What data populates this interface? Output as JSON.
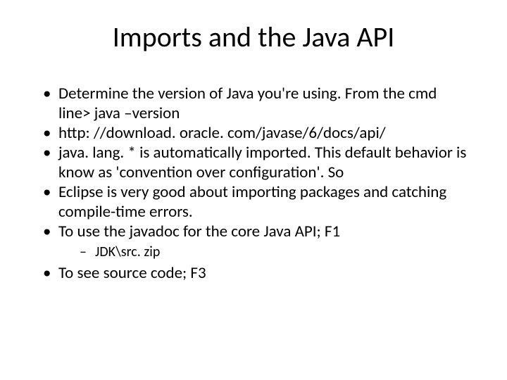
{
  "title": "Imports and the Java API",
  "bullets": {
    "b1": "Determine the version of Java you're using. From the cmd line> java –version",
    "b2": "http: //download. oracle. com/javase/6/docs/api/",
    "b3": "java. lang. * is automatically imported. This default behavior is know as 'convention over configuration'. So",
    "b4": "Eclipse is very good about importing packages  and catching compile-time errors.",
    "b5": "To use the javadoc for the  core Java API;  F1",
    "b5_sub1": "JDK\\src. zip",
    "b6": "To see source code; F3"
  }
}
